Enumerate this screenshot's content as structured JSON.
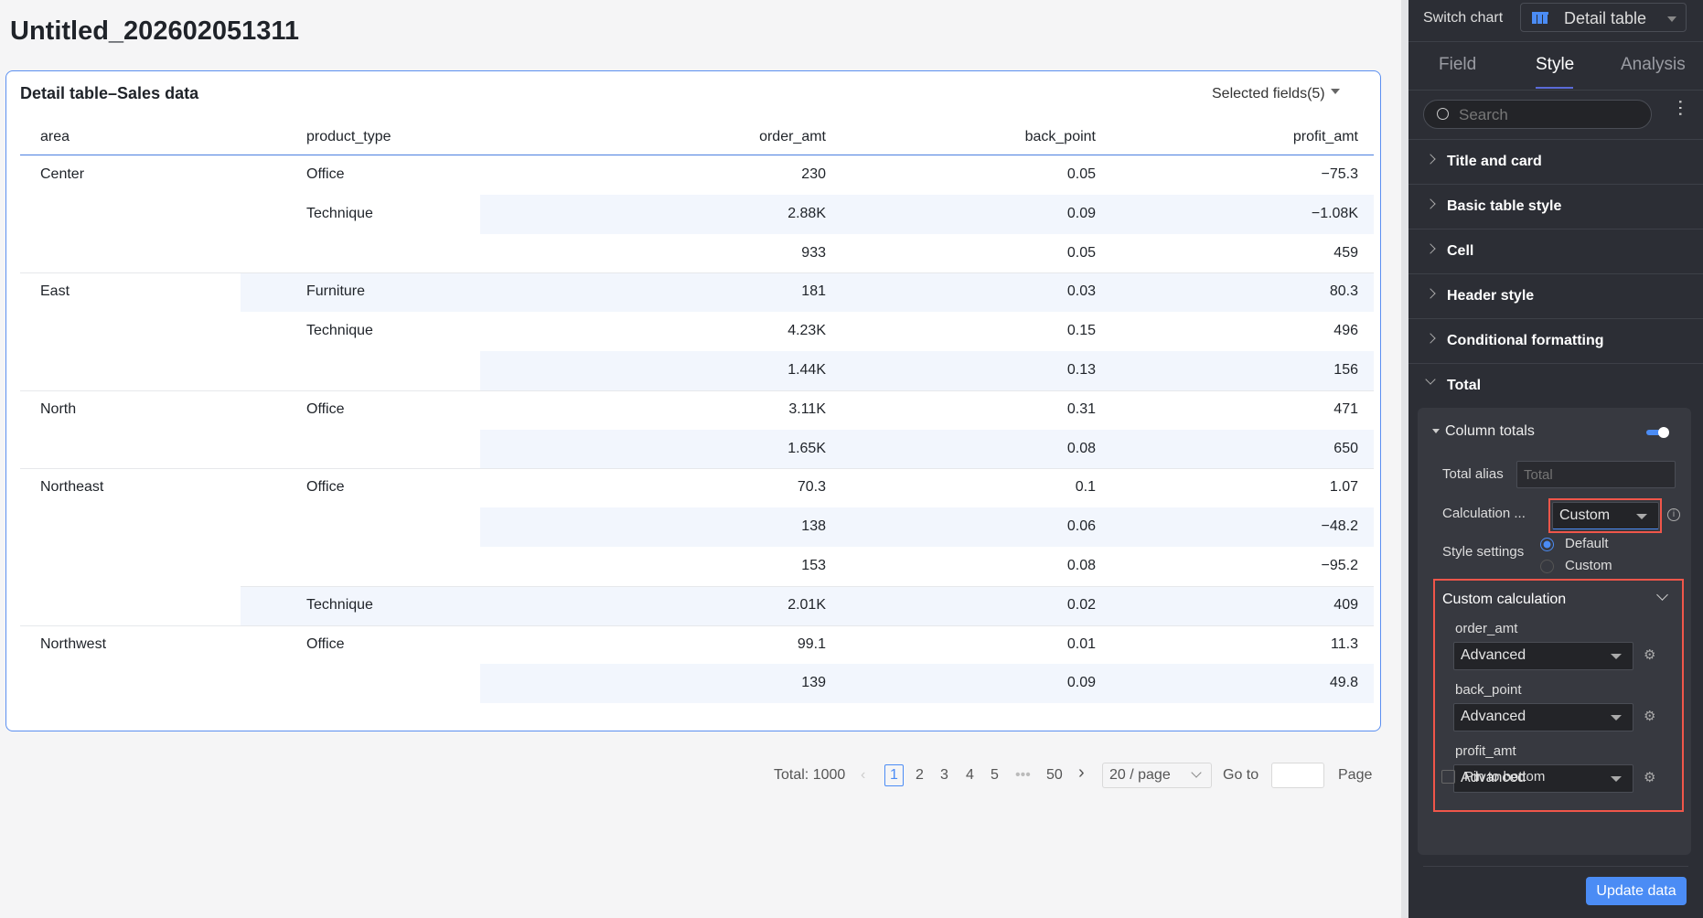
{
  "page_title": "Untitled_202602051311",
  "card": {
    "title": "Detail table–Sales data",
    "selected_fields": "Selected fields(5)"
  },
  "table": {
    "headers": [
      "area",
      "product_type",
      "order_amt",
      "back_point",
      "profit_amt"
    ],
    "rows": [
      {
        "area": "Center",
        "product": "Office",
        "order_amt": "230",
        "back_point": "0.05",
        "profit_amt": "−75.3"
      },
      {
        "area": "",
        "product": "Technique",
        "order_amt": "2.88K",
        "back_point": "0.09",
        "profit_amt": "−1.08K"
      },
      {
        "area": "",
        "product": "",
        "order_amt": "933",
        "back_point": "0.05",
        "profit_amt": "459"
      },
      {
        "area": "East",
        "product": "Furniture",
        "order_amt": "181",
        "back_point": "0.03",
        "profit_amt": "80.3"
      },
      {
        "area": "",
        "product": "Technique",
        "order_amt": "4.23K",
        "back_point": "0.15",
        "profit_amt": "496"
      },
      {
        "area": "",
        "product": "",
        "order_amt": "1.44K",
        "back_point": "0.13",
        "profit_amt": "156"
      },
      {
        "area": "North",
        "product": "Office",
        "order_amt": "3.11K",
        "back_point": "0.31",
        "profit_amt": "471"
      },
      {
        "area": "",
        "product": "",
        "order_amt": "1.65K",
        "back_point": "0.08",
        "profit_amt": "650"
      },
      {
        "area": "Northeast",
        "product": "Office",
        "order_amt": "70.3",
        "back_point": "0.1",
        "profit_amt": "1.07"
      },
      {
        "area": "",
        "product": "",
        "order_amt": "138",
        "back_point": "0.06",
        "profit_amt": "−48.2"
      },
      {
        "area": "",
        "product": "",
        "order_amt": "153",
        "back_point": "0.08",
        "profit_amt": "−95.2"
      },
      {
        "area": "",
        "product": "Technique",
        "order_amt": "2.01K",
        "back_point": "0.02",
        "profit_amt": "409"
      },
      {
        "area": "Northwest",
        "product": "Office",
        "order_amt": "99.1",
        "back_point": "0.01",
        "profit_amt": "11.3"
      },
      {
        "area": "",
        "product": "",
        "order_amt": "139",
        "back_point": "0.09",
        "profit_amt": "49.8"
      }
    ]
  },
  "pagination": {
    "total": "Total: 1000",
    "pages": [
      "1",
      "2",
      "3",
      "4",
      "5",
      "•••",
      "50"
    ],
    "current": "1",
    "page_size": "20 / page",
    "goto": "Go to",
    "page": "Page",
    "goto_value": ""
  },
  "panel": {
    "switch_chart": "Switch chart",
    "chart_type": "Detail table",
    "tabs": [
      "Field",
      "Style",
      "Analysis"
    ],
    "active_tab": "Style",
    "search_placeholder": "Search",
    "sections": [
      "Title and card",
      "Basic table style",
      "Cell",
      "Header style",
      "Conditional formatting"
    ],
    "total": "Total",
    "column_totals": "Column totals",
    "column_totals_on": true,
    "total_alias_label": "Total alias",
    "total_alias_placeholder": "Total",
    "calculation_label": "Calculation ...",
    "calculation_value": "Custom",
    "style_settings_label": "Style settings",
    "style_options": [
      "Default",
      "Custom"
    ],
    "custom_calc": "Custom calculation",
    "fields": [
      {
        "name": "order_amt",
        "method": "Advanced"
      },
      {
        "name": "back_point",
        "method": "Advanced"
      },
      {
        "name": "profit_amt",
        "method": "Advanced"
      }
    ],
    "pin_to_bottom": "Pin to bottom",
    "update": "Update data",
    "colors": {
      "accent": "#4b8cf5",
      "highlight": "#f0564a"
    }
  }
}
